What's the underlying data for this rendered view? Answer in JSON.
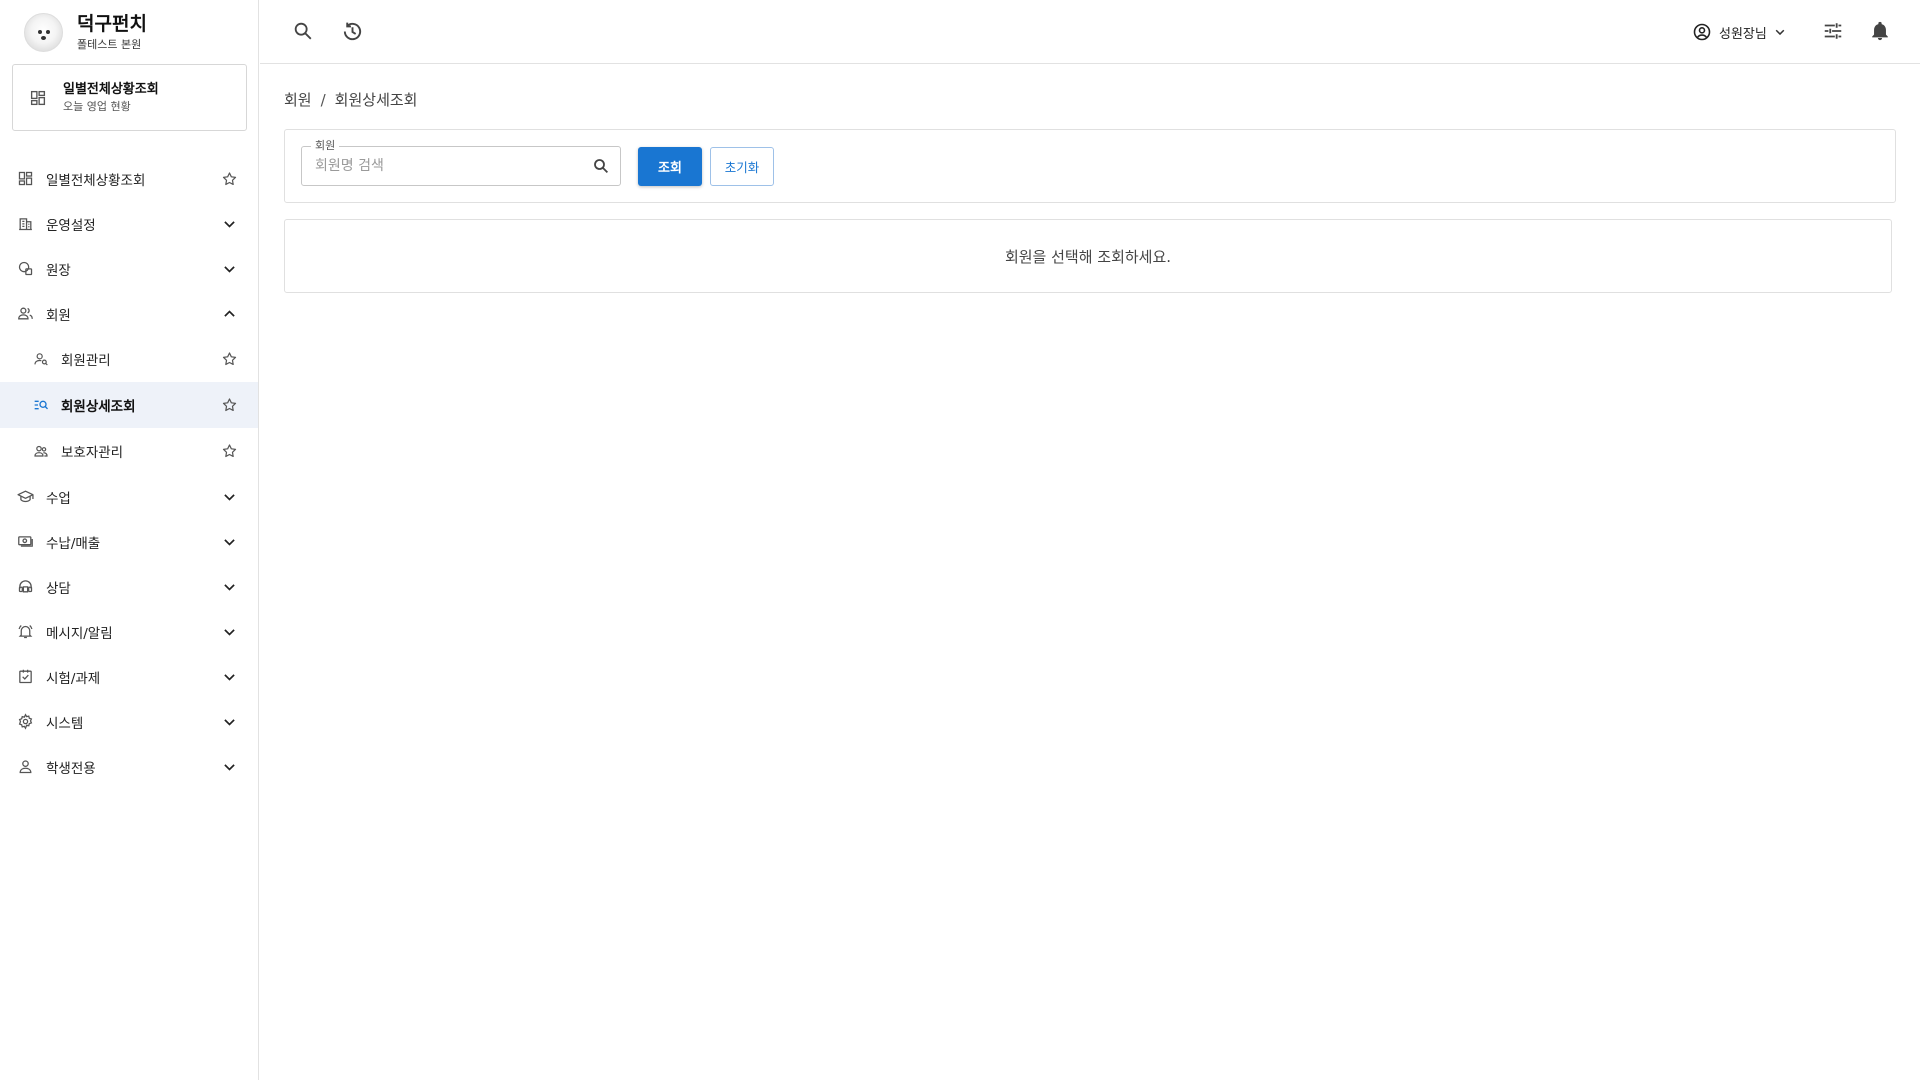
{
  "brand": {
    "name": "덕구펀치",
    "branch": "폴테스트 본원"
  },
  "dashboard_card": {
    "title": "일별전체상황조회",
    "subtitle": "오늘 영업 현황",
    "icon": "dashboard-icon"
  },
  "sidebar": {
    "items": [
      {
        "label": "일별전체상황조회",
        "icon": "dashboard-icon",
        "trail": "star"
      },
      {
        "label": "운영설정",
        "icon": "building-icon",
        "trail": "chevron-down"
      },
      {
        "label": "원장",
        "icon": "academy-icon",
        "trail": "chevron-down"
      },
      {
        "label": "회원",
        "icon": "people-icon",
        "trail": "chevron-up",
        "expanded": true
      },
      {
        "label": "회원관리",
        "icon": "person-search-icon",
        "trail": "star",
        "sub": true
      },
      {
        "label": "회원상세조회",
        "icon": "list-search-icon",
        "trail": "star",
        "sub": true,
        "active": true
      },
      {
        "label": "보호자관리",
        "icon": "guardian-icon",
        "trail": "star",
        "sub": true
      },
      {
        "label": "수업",
        "icon": "school-icon",
        "trail": "chevron-down"
      },
      {
        "label": "수납/매출",
        "icon": "payment-icon",
        "trail": "chevron-down"
      },
      {
        "label": "상담",
        "icon": "headset-icon",
        "trail": "chevron-down"
      },
      {
        "label": "메시지/알림",
        "icon": "notification-icon",
        "trail": "chevron-down"
      },
      {
        "label": "시험/과제",
        "icon": "assignment-icon",
        "trail": "chevron-down"
      },
      {
        "label": "시스템",
        "icon": "settings-icon",
        "trail": "chevron-down"
      },
      {
        "label": "학생전용",
        "icon": "student-icon",
        "trail": "chevron-down"
      }
    ]
  },
  "topbar": {
    "user_name": "성원장님",
    "icons": [
      "search-icon",
      "history-icon",
      "account-icon",
      "tune-icon",
      "bell-icon"
    ]
  },
  "breadcrumb": {
    "parent": "회원",
    "separator": "/",
    "current": "회원상세조회"
  },
  "search": {
    "field_label": "회원",
    "placeholder": "회원명 검색",
    "value": "",
    "search_button": "조회",
    "reset_button": "초기화"
  },
  "result": {
    "empty_message": "회원을 선택해 조회하세요."
  },
  "colors": {
    "primary": "#1976d2",
    "active_bg": "#eef2f9",
    "border": "#e0e0e0"
  }
}
